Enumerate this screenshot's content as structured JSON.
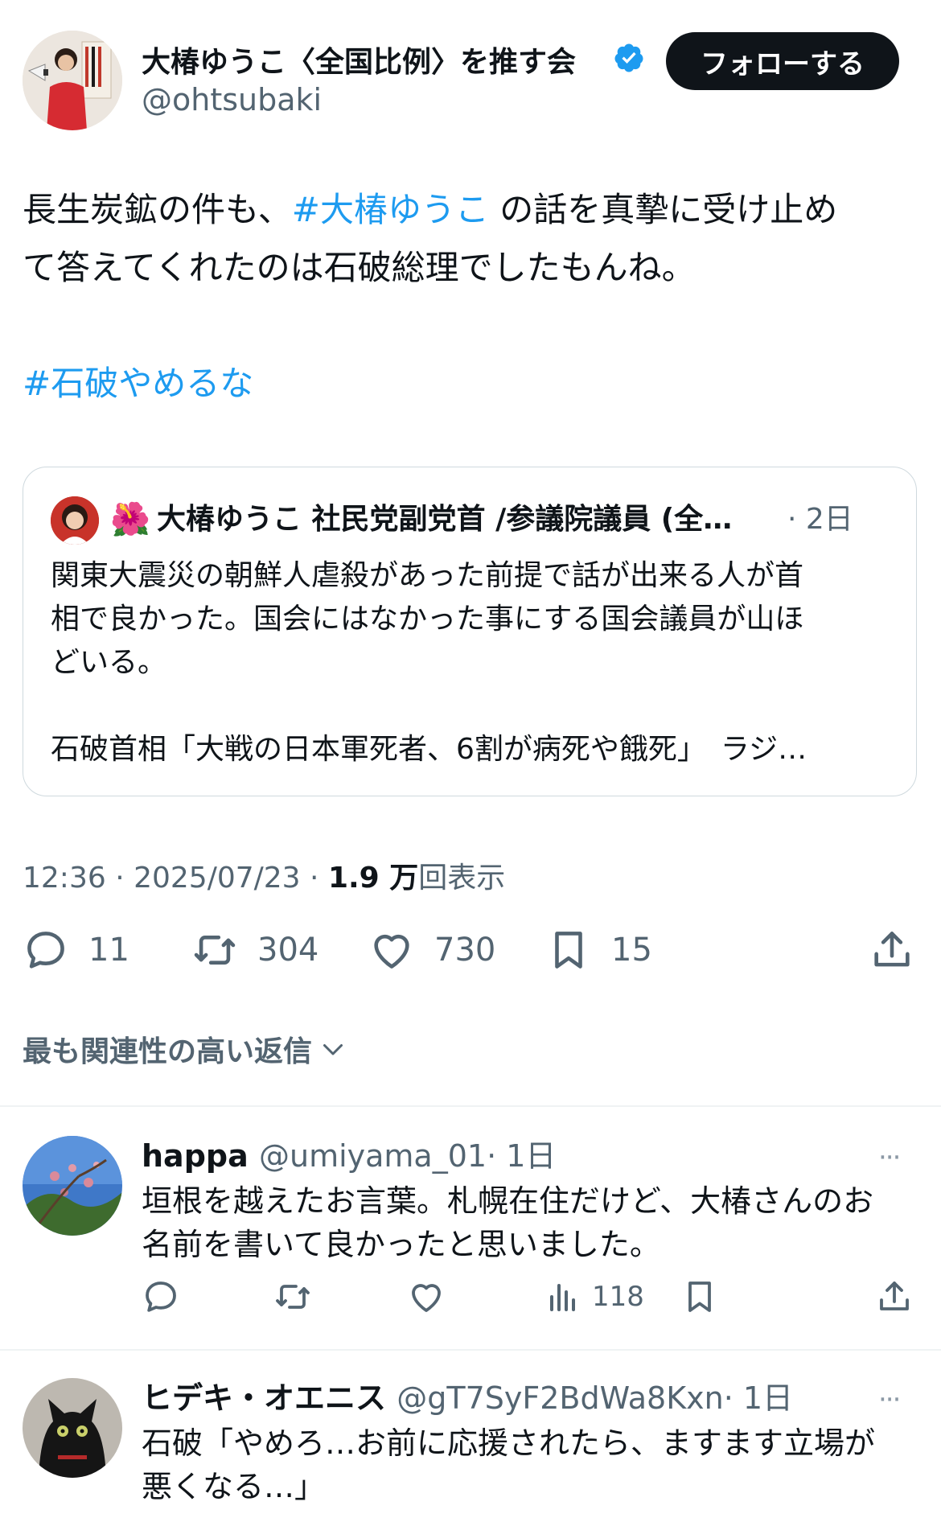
{
  "tweet": {
    "author": {
      "name": "大椿ゆうこ〈全国比例〉を推す会",
      "handle": "@ohtsubaki",
      "verified": true
    },
    "follow_label": "フォローする",
    "text": {
      "line1_pre": "長生炭鉱の件も、",
      "line1_tag": "#大椿ゆうこ",
      "line1_post": " の話を真摯に受け止め",
      "line2": "て答えてくれたのは石破総理でしたもんね。",
      "tag2": "#石破やめるな"
    },
    "quote": {
      "flower": "🌺",
      "name": "大椿ゆうこ 社民党副党首 /参議院議員 (全…",
      "time": "· 2日",
      "lines": [
        "関東大震災の朝鮮人虐殺があった前提で話が出来る人が首",
        "相で良かった。国会にはなかった事にする国会議員が山ほ",
        "どいる。",
        "",
        "石破首相「大戦の日本軍死者、6割が病死や餓死」　ラジ…"
      ]
    },
    "meta": {
      "time": "12:36",
      "date": "2025/07/23",
      "views_count": "1.9 万",
      "views_label": "回表示"
    },
    "stats": {
      "replies": "11",
      "retweets": "304",
      "likes": "730",
      "bookmarks": "15"
    }
  },
  "sort_label": "最も関連性の高い返信",
  "replies": [
    {
      "name": "happa",
      "handle": "@umiyama_01",
      "time": "· 1日",
      "more": "···",
      "lines": [
        "垣根を越えたお言葉。札幌在住だけど、大椿さんのお",
        "名前を書いて良かったと思いました。"
      ],
      "views": "118"
    },
    {
      "name": "ヒデキ・オエニス",
      "handle": "@gT7SyF2BdWa8Kxn",
      "time": "· 1日",
      "more": "···",
      "lines": [
        "石破「やめろ…お前に応援されたら、ますます立場が",
        "悪くなる…」"
      ]
    }
  ],
  "colors": {
    "link": "#1d9bf0",
    "secondary_text": "#536471",
    "primary_text": "#0f1419",
    "follow_button_bg": "#0f1419",
    "divider": "#eff3f4"
  },
  "icons": [
    "verified-badge-icon",
    "reply-icon",
    "retweet-icon",
    "like-icon",
    "bookmark-icon",
    "share-icon",
    "views-icon",
    "chevron-down-icon",
    "more-icon"
  ]
}
